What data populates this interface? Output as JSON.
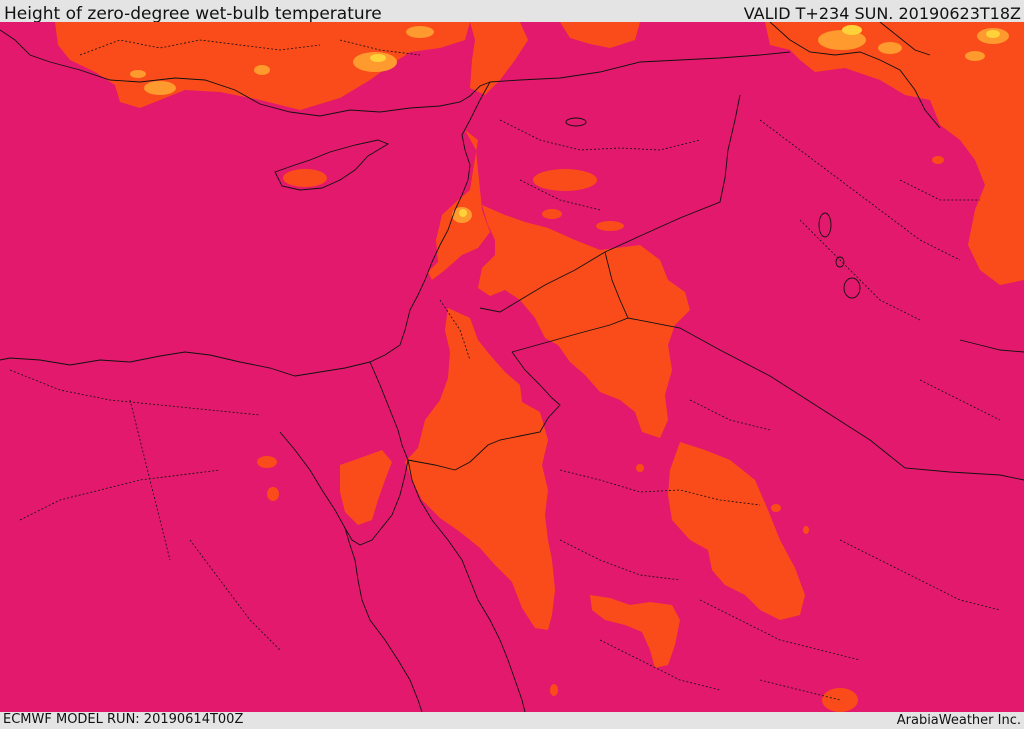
{
  "header": {
    "title": "Height of zero-degree wet-bulb temperature",
    "valid_time": "VALID T+234 SUN. 20190623T18Z"
  },
  "footer": {
    "model_run": "ECMWF MODEL RUN: 20190614T00Z",
    "credit": "ArabiaWeather Inc."
  },
  "map": {
    "colors": {
      "background_field": "#e2196c",
      "warm_band": "#fa4c1a",
      "warmer_band": "#ff9a2e",
      "warmest_band": "#ffd23a",
      "border_line": "#111111"
    }
  }
}
